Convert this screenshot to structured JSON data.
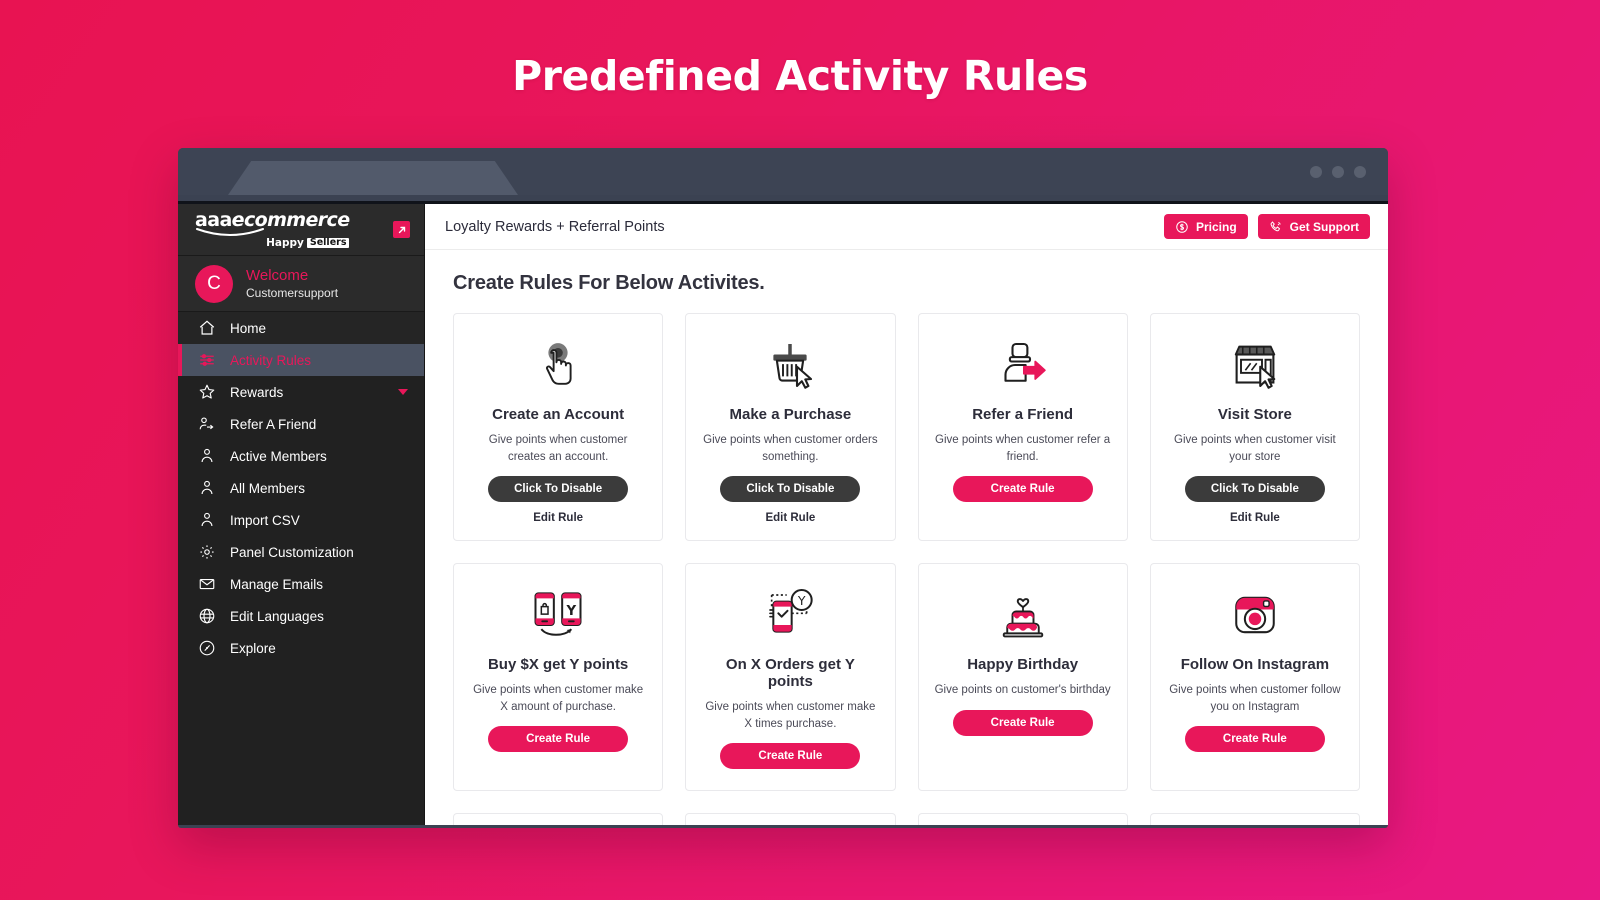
{
  "banner": {
    "title": "Predefined Activity Rules"
  },
  "browser": {
    "dots_count": 3
  },
  "sidebar": {
    "brand": {
      "line1_a": "aaa",
      "line1_b": "ecommerce",
      "happy": "Happy",
      "sellers": "Sellers",
      "expand_icon": "expand-icon"
    },
    "user": {
      "avatar_initial": "C",
      "welcome": "Welcome",
      "name": "Customersupport"
    },
    "items": [
      {
        "label": "Home",
        "icon": "home-icon",
        "active": false
      },
      {
        "label": "Activity Rules",
        "icon": "sliders-icon",
        "active": true
      },
      {
        "label": "Rewards",
        "icon": "star-icon",
        "active": false,
        "caret": true
      },
      {
        "label": "Refer A Friend",
        "icon": "refer-person-icon",
        "active": false
      },
      {
        "label": "Active Members",
        "icon": "user-icon",
        "active": false
      },
      {
        "label": "All Members",
        "icon": "user-icon",
        "active": false
      },
      {
        "label": "Import CSV",
        "icon": "user-icon",
        "active": false
      },
      {
        "label": "Panel Customization",
        "icon": "gear-icon",
        "active": false
      },
      {
        "label": "Manage Emails",
        "icon": "envelope-icon",
        "active": false
      },
      {
        "label": "Edit Languages",
        "icon": "globe-icon",
        "active": false
      },
      {
        "label": "Explore",
        "icon": "compass-icon",
        "active": false
      }
    ]
  },
  "topbar": {
    "title": "Loyalty Rewards + Referral Points",
    "pricing_label": "Pricing",
    "pricing_icon": "dollar-circle-icon",
    "support_label": "Get Support",
    "support_icon": "phone-ring-icon"
  },
  "main": {
    "section_title": "Create Rules For Below Activites.",
    "cards": [
      {
        "title": "Create an Account",
        "desc": "Give points when customer creates an account.",
        "button": "Click To Disable",
        "button_style": "disable",
        "edit": "Edit Rule",
        "icon": "hand-click-icon"
      },
      {
        "title": "Make a Purchase",
        "desc": "Give points when customer orders something.",
        "button": "Click To Disable",
        "button_style": "disable",
        "edit": "Edit Rule",
        "icon": "basket-cursor-icon"
      },
      {
        "title": "Refer a Friend",
        "desc": "Give points when customer refer a friend.",
        "button": "Create Rule",
        "button_style": "create",
        "edit": "",
        "icon": "person-arrow-icon"
      },
      {
        "title": "Visit Store",
        "desc": "Give points when customer visit your store",
        "button": "Click To Disable",
        "button_style": "disable",
        "edit": "Edit Rule",
        "icon": "storefront-cursor-icon"
      },
      {
        "title": "Buy $X get Y points",
        "desc": "Give points when customer make X amount of purchase.",
        "button": "Create Rule",
        "button_style": "create",
        "edit": "",
        "icon": "two-phones-icon"
      },
      {
        "title": "On X Orders get Y points",
        "desc": "Give points when customer make X times purchase.",
        "button": "Create Rule",
        "button_style": "create",
        "edit": "",
        "icon": "phone-check-y-icon"
      },
      {
        "title": "Happy Birthday",
        "desc": "Give points on customer's birthday",
        "button": "Create Rule",
        "button_style": "create",
        "edit": "",
        "icon": "birthday-cake-icon"
      },
      {
        "title": "Follow On Instagram",
        "desc": "Give points when customer follow you on Instagram",
        "button": "Create Rule",
        "button_style": "create",
        "edit": "",
        "icon": "instagram-icon"
      }
    ]
  },
  "colors": {
    "accent": "#e8175a",
    "sidebar_bg": "#212121",
    "sidebar_active_bg": "#4a5262",
    "dark_button": "#3b3b3b",
    "chrome_bg": "#3b4252",
    "page_bg_start": "#e81352",
    "page_bg_end": "#e81884"
  }
}
